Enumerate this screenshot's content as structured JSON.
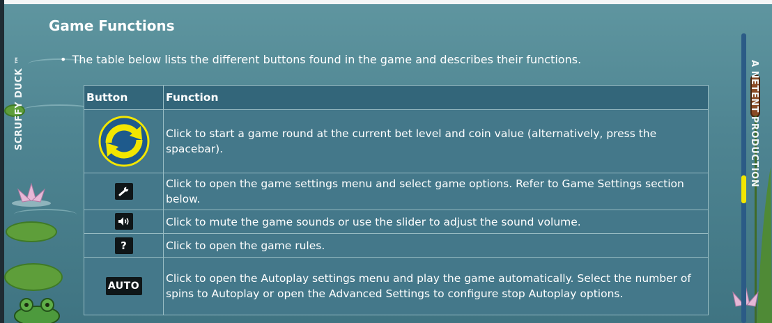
{
  "page": {
    "heading": "Game Functions",
    "intro": "The table below lists the different buttons found in the game and describes their functions.",
    "side_left_title": "SCRUFFY DUCK ™",
    "side_right_title": "A NETENT PRODUCTION"
  },
  "table": {
    "headers": {
      "button": "Button",
      "function": "Function"
    },
    "rows": [
      {
        "icon": "spin-icon",
        "text": "Click to start a game round at the current bet level and coin value (alternatively, press the spacebar)."
      },
      {
        "icon": "wrench-icon",
        "text": "Click to open the game settings menu and select game options. Refer to Game Settings section below."
      },
      {
        "icon": "speaker-icon",
        "text": "Click to mute the game sounds or use the slider to adjust the sound volume."
      },
      {
        "icon": "question-icon",
        "icon_label": "?",
        "text": "Click to open the game rules."
      },
      {
        "icon": "autoplay-icon",
        "icon_label": "AUTO",
        "text": "Click to open the Autoplay settings menu and play the game automatically. Select the number of spins to Autoplay or open the Advanced Settings to configure stop Autoplay options."
      }
    ]
  },
  "colors": {
    "background": "#4f8592",
    "table_header": "#33667a",
    "table_cell": "#44788a",
    "spin_button_blue": "#1e5a8c",
    "spin_button_yellow": "#f2e600",
    "scroll_thumb": "#f2e600"
  }
}
